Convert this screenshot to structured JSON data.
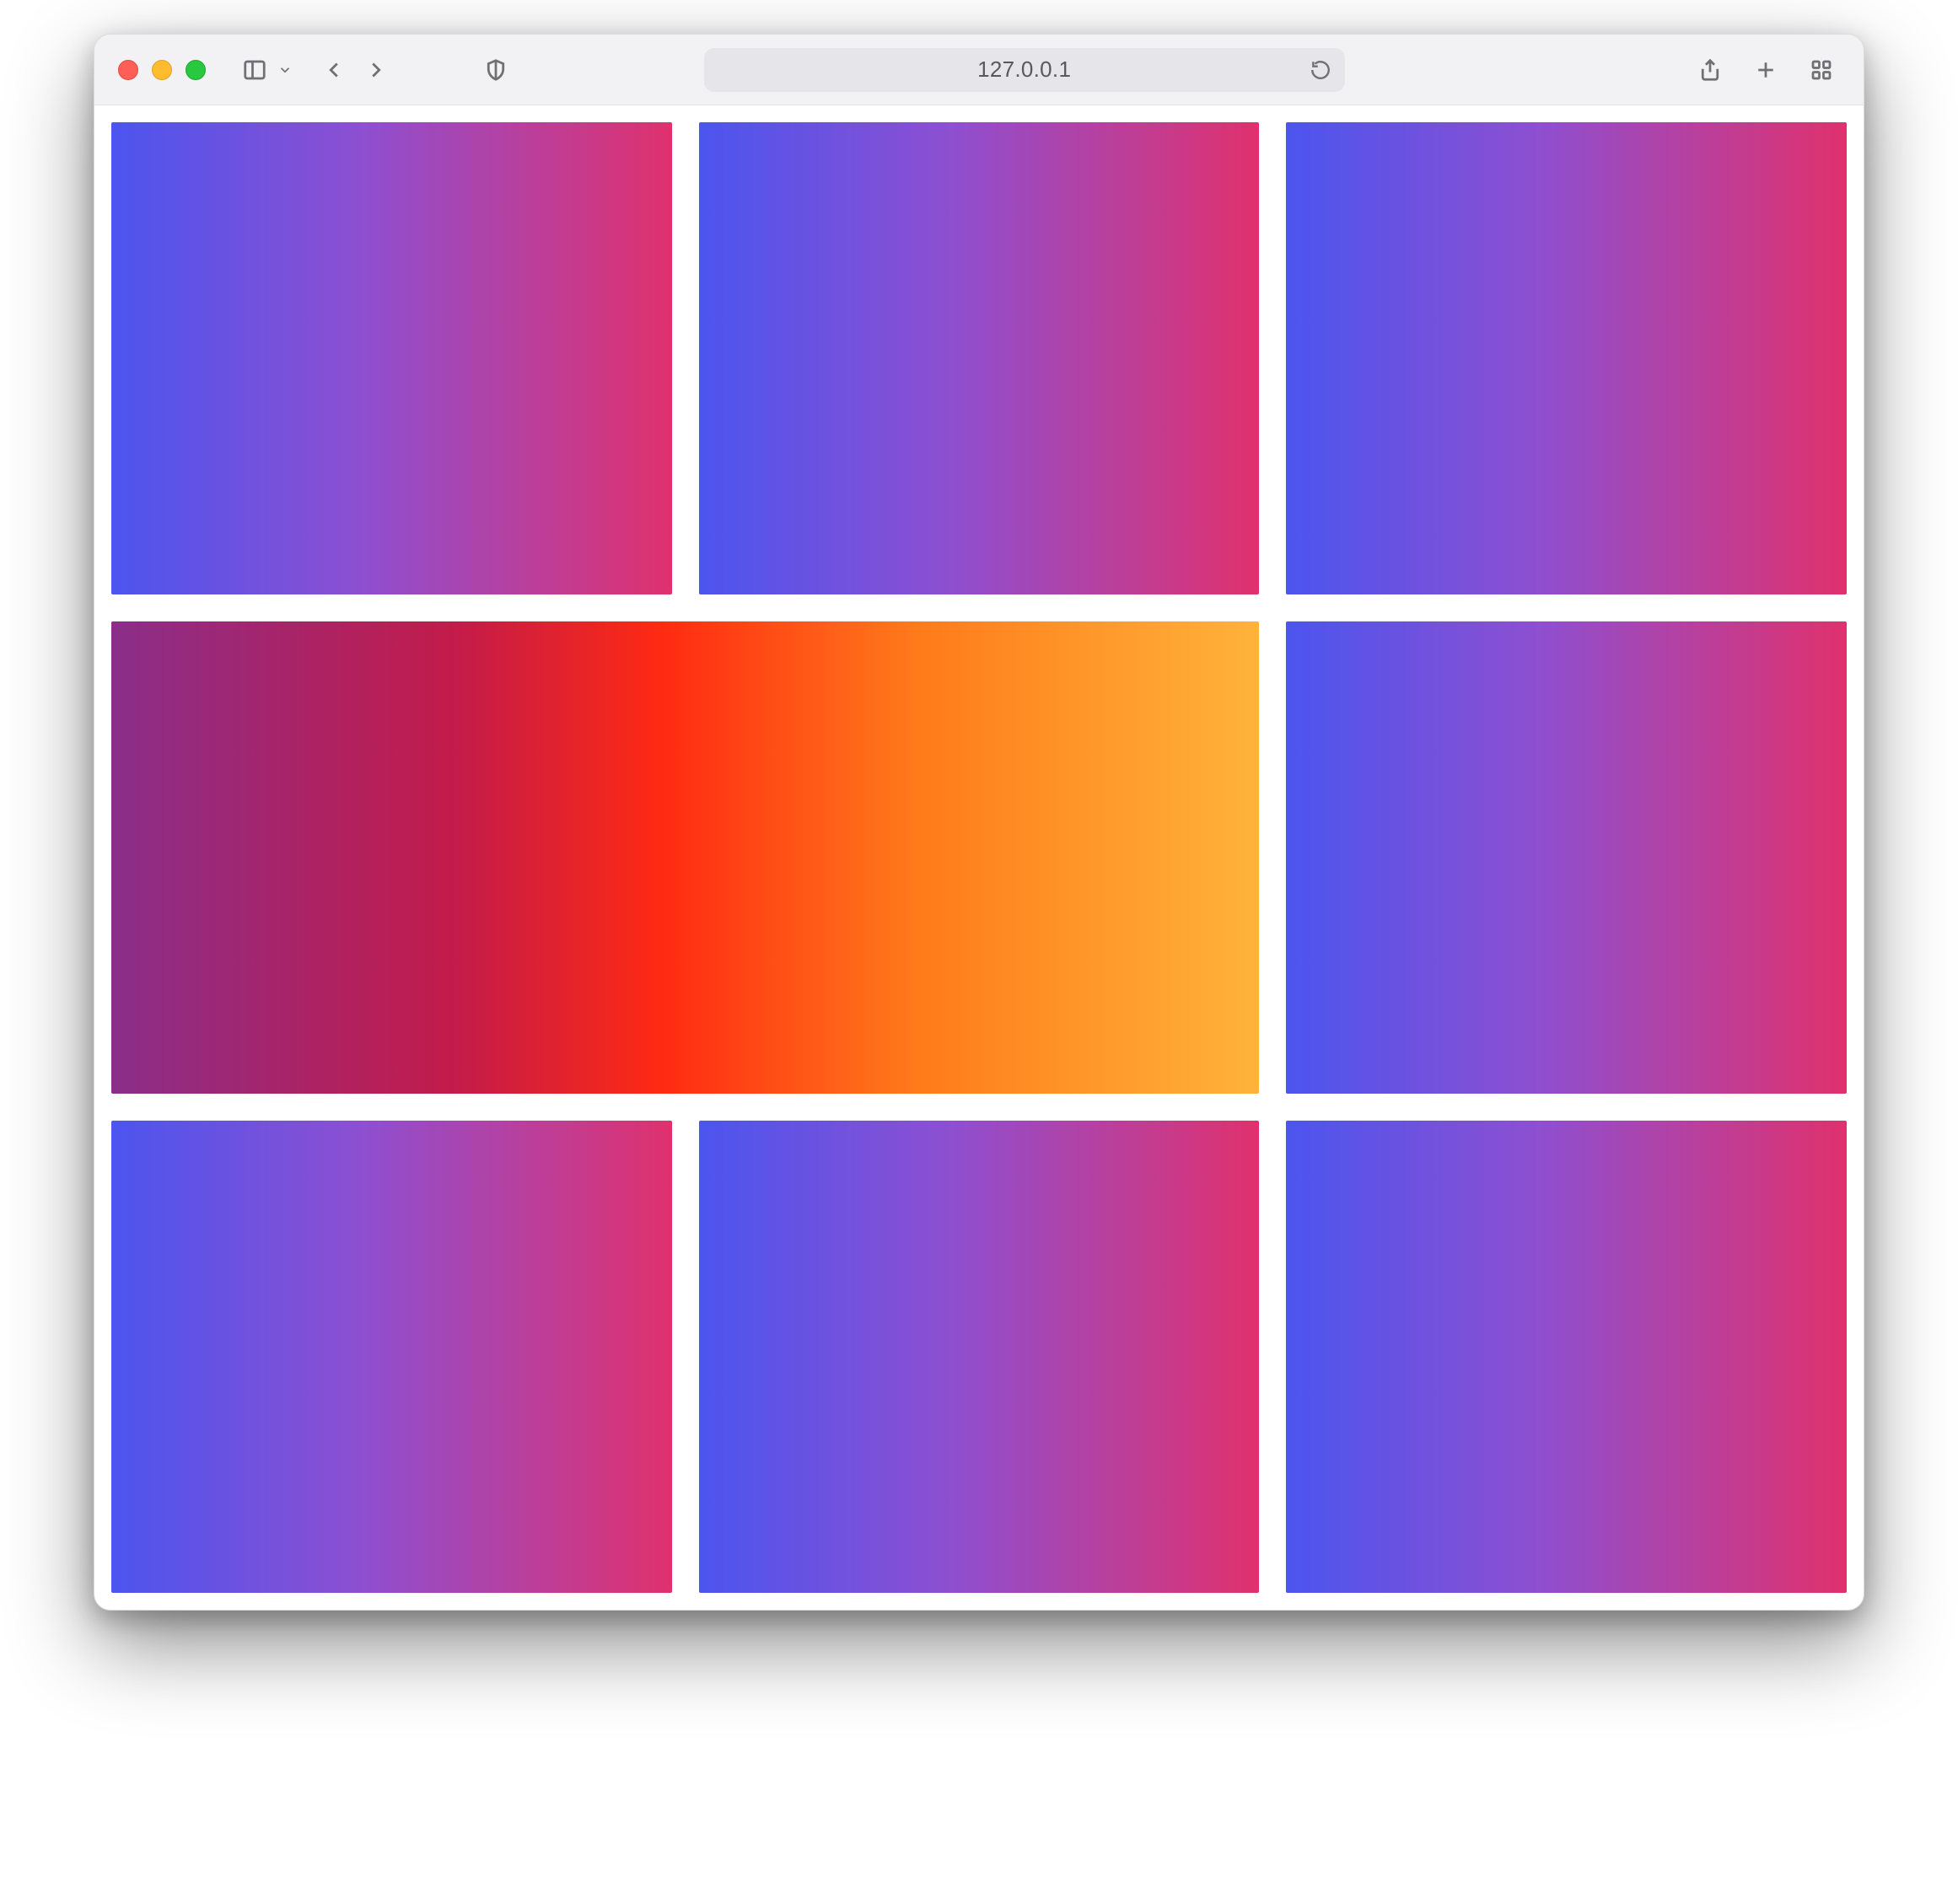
{
  "browser": {
    "address": "127.0.0.1"
  },
  "grid": {
    "tiles": [
      {
        "variant": "default",
        "span": 1
      },
      {
        "variant": "default",
        "span": 1
      },
      {
        "variant": "default",
        "span": 1
      },
      {
        "variant": "featured",
        "span": 2
      },
      {
        "variant": "default",
        "span": 1
      },
      {
        "variant": "default",
        "span": 1
      },
      {
        "variant": "default",
        "span": 1
      },
      {
        "variant": "default",
        "span": 1
      }
    ]
  },
  "colors": {
    "default_gradient": [
      "#4b55ef",
      "#8e4fd0",
      "#e0316d"
    ],
    "featured_gradient": [
      "#8a2e8a",
      "#c31b4a",
      "#ff2a12",
      "#ff7a1a",
      "#ffb33a"
    ]
  }
}
